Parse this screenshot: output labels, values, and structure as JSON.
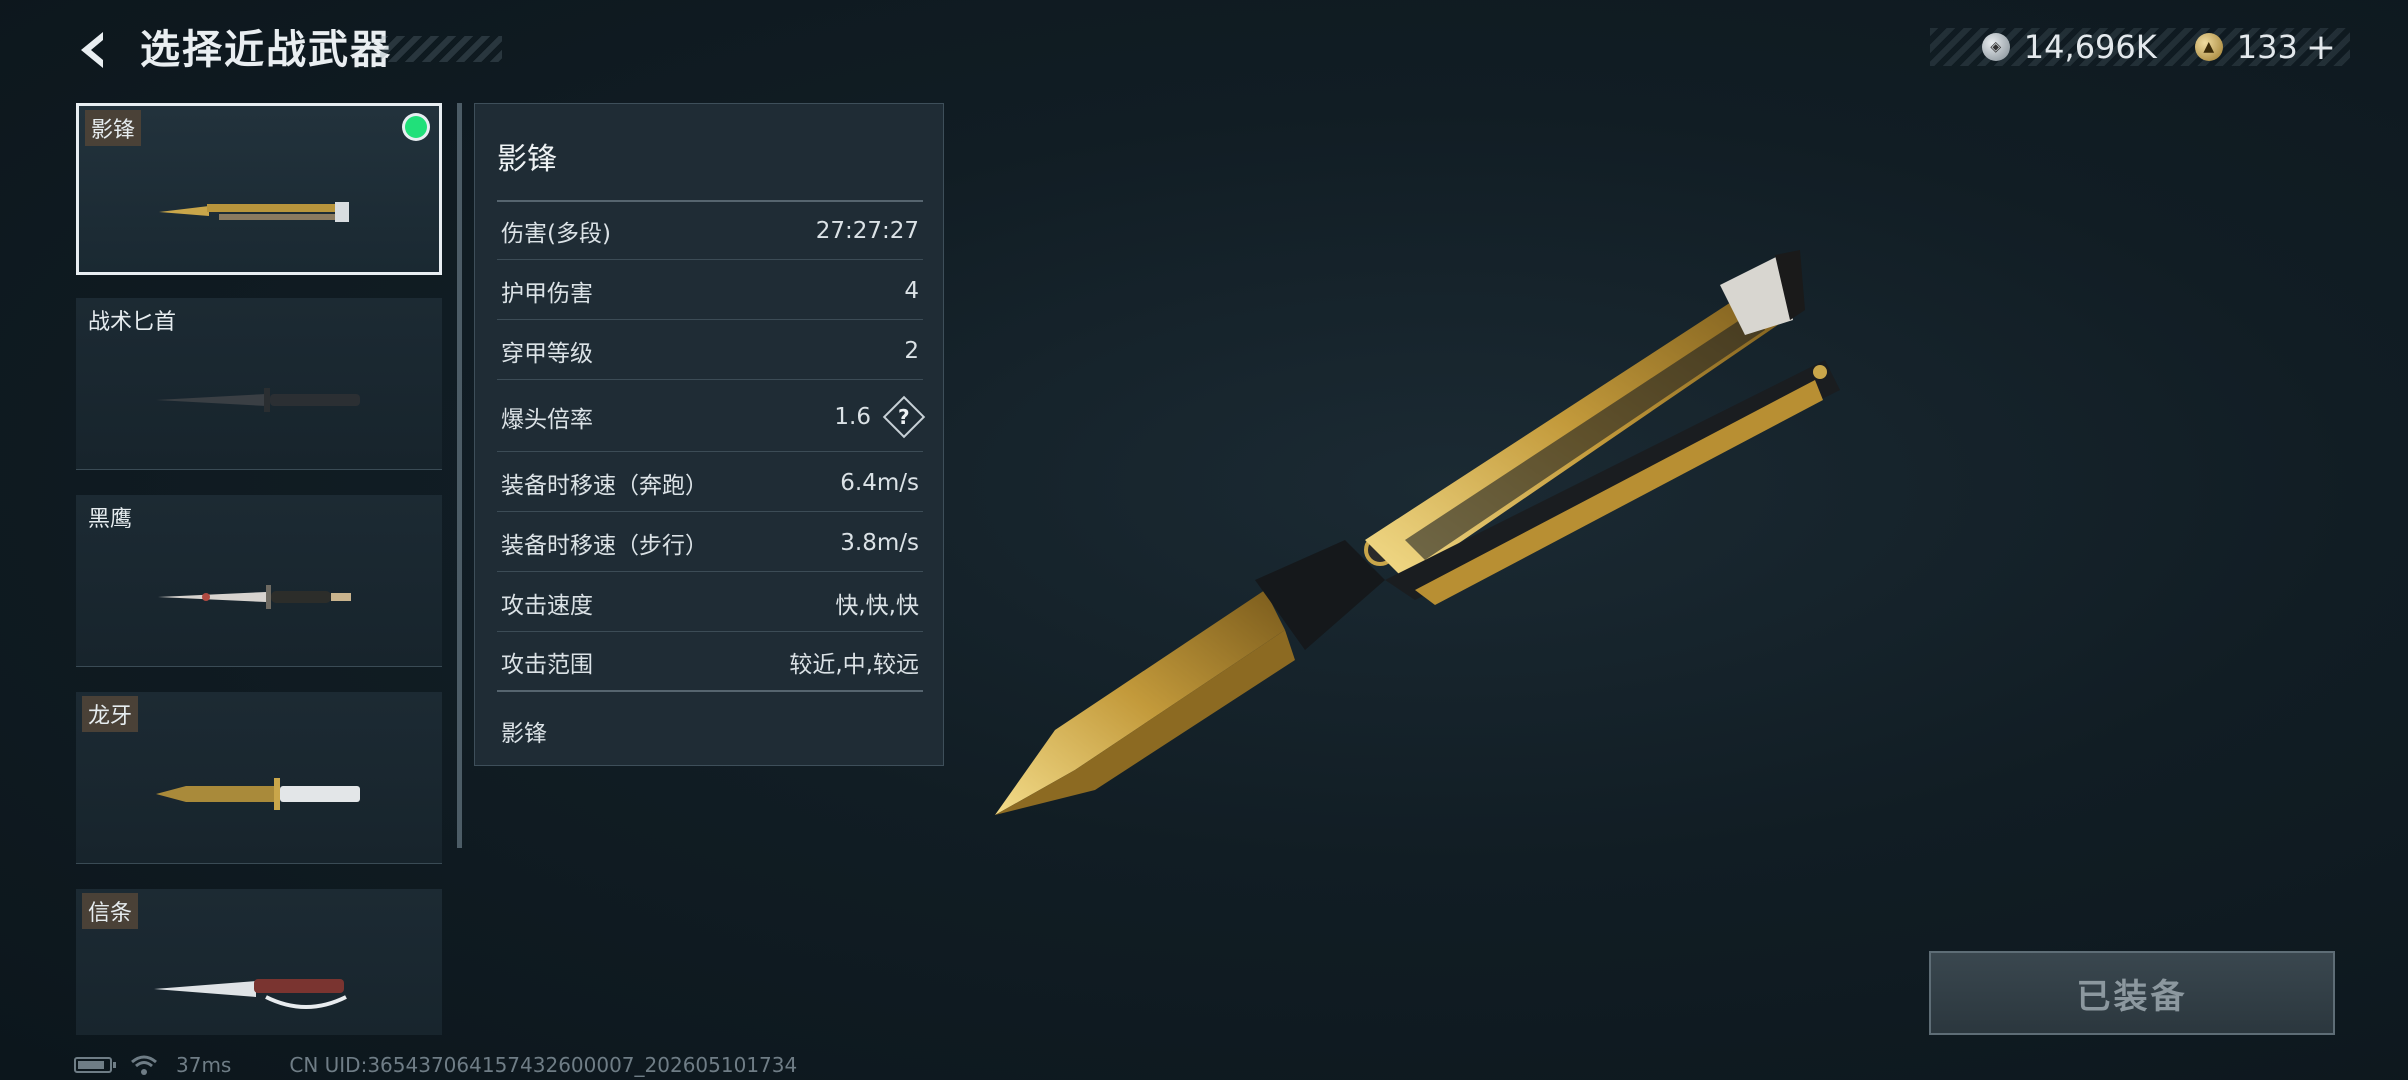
{
  "header": {
    "title": "选择近战武器"
  },
  "currency": {
    "silver_value": "14,696K",
    "gold_value": "133",
    "plus_label": "+"
  },
  "weapons": [
    {
      "name": "影锋",
      "selected": true,
      "equipped": true
    },
    {
      "name": "战术匕首",
      "selected": false
    },
    {
      "name": "黑鹰",
      "selected": false
    },
    {
      "name": "龙牙",
      "selected": false
    },
    {
      "name": "信条",
      "selected": false
    }
  ],
  "stats": {
    "title": "影锋",
    "rows": [
      {
        "label": "伤害(多段)",
        "value": "27:27:27"
      },
      {
        "label": "护甲伤害",
        "value": "4"
      },
      {
        "label": "穿甲等级",
        "value": "2"
      },
      {
        "label": "爆头倍率",
        "value": "1.6"
      },
      {
        "label": "装备时移速（奔跑）",
        "value": "6.4m/s"
      },
      {
        "label": "装备时移速（步行）",
        "value": "3.8m/s"
      },
      {
        "label": "攻击速度",
        "value": "快,快,快"
      },
      {
        "label": "攻击范围",
        "value": "较近,中,较远"
      }
    ],
    "footer": "影锋"
  },
  "equip_button": {
    "label": "已装备"
  },
  "status_bar": {
    "ping": "37ms",
    "uid": "CN UID:365437064157432600007_202605101734"
  },
  "colors": {
    "equipped_dot": "#21e07a",
    "gold": "#c9a64a",
    "panel_bg": "#1f2c35"
  }
}
